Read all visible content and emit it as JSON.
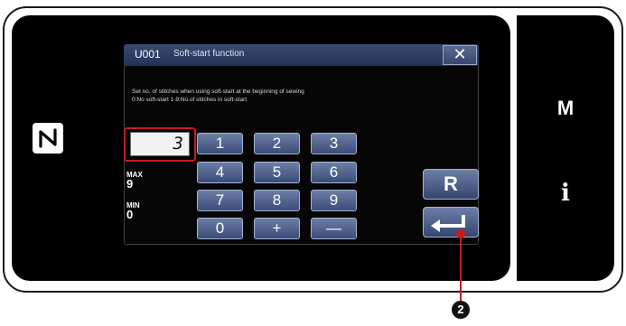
{
  "dialog": {
    "code": "U001",
    "title": "Soft-start function",
    "close_glyph": "✕",
    "description_line1": "Set no. of stitches when using soft-start at the beginning of sewing",
    "description_line2": "0:No soft-start 1-9:No.of stitches in soft-start"
  },
  "input": {
    "value": "3"
  },
  "limits": {
    "max_label": "MAX",
    "max_value": "9",
    "min_label": "MIN",
    "min_value": "0"
  },
  "keypad": {
    "k1": "1",
    "k2": "2",
    "k3": "3",
    "k4": "4",
    "k5": "5",
    "k6": "6",
    "k7": "7",
    "k8": "8",
    "k9": "9",
    "k0": "0",
    "plus": "+",
    "minus": "—"
  },
  "buttons": {
    "reset": "R",
    "enter_icon": "enter-icon"
  },
  "side": {
    "mode_label": "M",
    "info_label": "i"
  },
  "nfc_icon": "nfc-icon",
  "callout": {
    "number": "2"
  },
  "colors": {
    "title_bar": "#2c3d66",
    "key": "#4e6090",
    "highlight": "#cc1a1a"
  }
}
